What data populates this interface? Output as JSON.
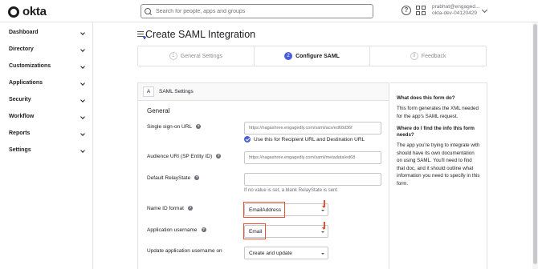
{
  "app": {
    "logo_text": "okta"
  },
  "header": {
    "search_placeholder": "Search for people, apps and groups",
    "user_name": "prabhat@engaged...",
    "user_org": "okta-dev-04120429"
  },
  "sidebar": {
    "items": [
      {
        "label": "Dashboard"
      },
      {
        "label": "Directory"
      },
      {
        "label": "Customizations"
      },
      {
        "label": "Applications"
      },
      {
        "label": "Security"
      },
      {
        "label": "Workflow"
      },
      {
        "label": "Reports"
      },
      {
        "label": "Settings"
      }
    ]
  },
  "page": {
    "title": "Create SAML Integration"
  },
  "stepper": {
    "steps": [
      {
        "num": "1",
        "label": "General Settings",
        "active": false
      },
      {
        "num": "2",
        "label": "Configure SAML",
        "active": true
      },
      {
        "num": "3",
        "label": "Feedback",
        "active": false
      }
    ]
  },
  "form": {
    "badge": "A",
    "card_title": "SAML Settings",
    "section_title": "General",
    "sso_url_label": "Single sign-on URL",
    "sso_url_value": "https://nagashree.engagedly.com/saml/acs/ed68d36f",
    "recipient_check_label": "Use this for Recipient URL and Destination URL",
    "audience_uri_label": "Audience URI (SP Entity ID)",
    "audience_uri_value": "https://nagashree.engagedly.com/saml/metadata/ed68",
    "relay_state_label": "Default RelayState",
    "relay_state_value": "",
    "relay_state_hint": "If no value is set, a blank RelayState is sent",
    "name_id_label": "Name ID format",
    "name_id_value": "EmailAddress",
    "app_username_label": "Application username",
    "app_username_value": "Email",
    "update_username_label": "Update application username on",
    "update_username_value": "Create and update",
    "info_glyph": "?"
  },
  "help": {
    "q1": "What does this form do?",
    "a1": "This form generates the XML needed for the app's SAML request.",
    "q2": "Where do I find the info this form needs?",
    "a2": "The app you're trying to integrate with should have its own documentation on using SAML. You'll need to find that doc, and it should outline what information you need to specify in this form."
  },
  "colors": {
    "accent": "#4b5ed7",
    "highlight": "#e8502e"
  }
}
